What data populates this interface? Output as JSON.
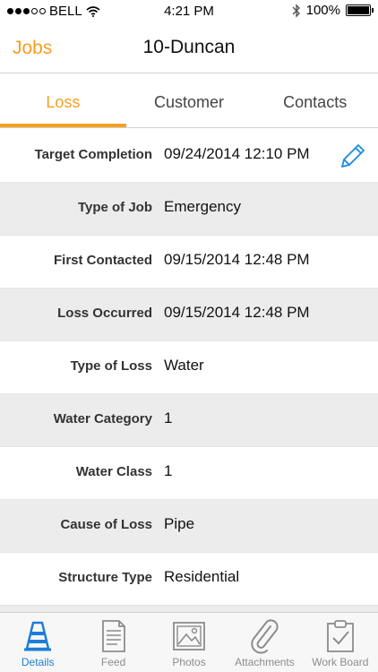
{
  "status_bar": {
    "carrier": "BELL",
    "time": "4:21 PM",
    "battery": "100%"
  },
  "nav": {
    "back_label": "Jobs",
    "title": "10-Duncan"
  },
  "tabs": [
    {
      "label": "Loss",
      "active": true
    },
    {
      "label": "Customer",
      "active": false
    },
    {
      "label": "Contacts",
      "active": false
    }
  ],
  "details": [
    {
      "label": "Target Completion",
      "value": "09/24/2014 12:10 PM"
    },
    {
      "label": "Type of Job",
      "value": "Emergency"
    },
    {
      "label": "First Contacted",
      "value": "09/15/2014 12:48 PM"
    },
    {
      "label": "Loss Occurred",
      "value": "09/15/2014 12:48 PM"
    },
    {
      "label": "Type of Loss",
      "value": "Water"
    },
    {
      "label": "Water Category",
      "value": "1"
    },
    {
      "label": "Water Class",
      "value": "1"
    },
    {
      "label": "Cause of Loss",
      "value": "Pipe"
    },
    {
      "label": "Structure Type",
      "value": "Residential"
    }
  ],
  "tab_bar": [
    {
      "label": "Details",
      "icon": "cone-icon",
      "active": true
    },
    {
      "label": "Feed",
      "icon": "document-icon",
      "active": false
    },
    {
      "label": "Photos",
      "icon": "photo-icon",
      "active": false
    },
    {
      "label": "Attachments",
      "icon": "paperclip-icon",
      "active": false
    },
    {
      "label": "Work Board",
      "icon": "clipboard-check-icon",
      "active": false
    }
  ],
  "colors": {
    "accent": "#f5a020",
    "active_tab_icon": "#1a7fd6",
    "inactive": "#8c8c8c"
  }
}
